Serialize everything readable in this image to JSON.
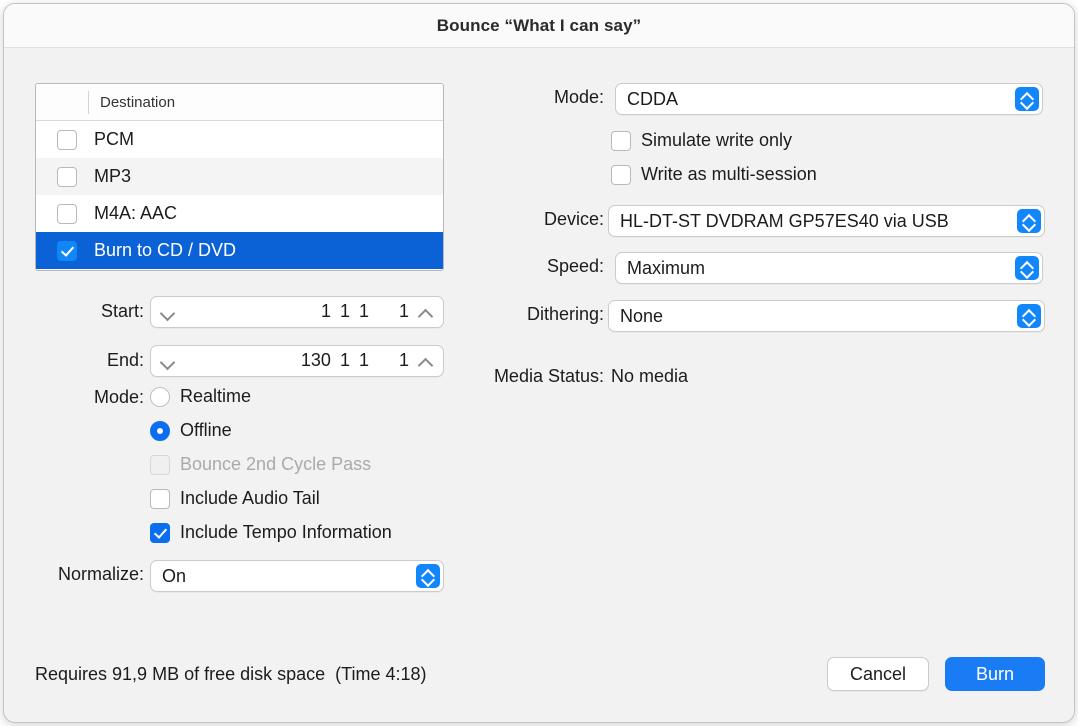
{
  "window": {
    "title": "Bounce “What I can say”"
  },
  "destination_table": {
    "column_header": "Destination",
    "rows": [
      {
        "label": "PCM",
        "checked": false,
        "selected": false
      },
      {
        "label": "MP3",
        "checked": false,
        "selected": false
      },
      {
        "label": "M4A: AAC",
        "checked": false,
        "selected": false
      },
      {
        "label": "Burn to CD / DVD",
        "checked": true,
        "selected": true
      }
    ]
  },
  "left_panel": {
    "start": {
      "label": "Start:",
      "values": [
        "1",
        "1",
        "1"
      ],
      "tick": "1",
      "decrement_icon": "chevron-down-icon",
      "increment_icon": "chevron-up-icon"
    },
    "end": {
      "label": "End:",
      "values": [
        "130",
        "1",
        "1"
      ],
      "tick": "1",
      "decrement_icon": "chevron-down-icon",
      "increment_icon": "chevron-up-icon"
    },
    "mode": {
      "label": "Mode:",
      "options": [
        {
          "label": "Realtime",
          "selected": false
        },
        {
          "label": "Offline",
          "selected": true
        }
      ]
    },
    "checkboxes": [
      {
        "label": "Bounce 2nd Cycle Pass",
        "checked": false,
        "disabled": true
      },
      {
        "label": "Include Audio Tail",
        "checked": false,
        "disabled": false
      },
      {
        "label": "Include Tempo Information",
        "checked": true,
        "disabled": false
      }
    ],
    "normalize": {
      "label": "Normalize:",
      "value": "On"
    }
  },
  "right_panel": {
    "mode": {
      "label": "Mode:",
      "value": "CDDA"
    },
    "checkboxes": [
      {
        "label": "Simulate write only",
        "checked": false
      },
      {
        "label": "Write as multi-session",
        "checked": false
      }
    ],
    "device": {
      "label": "Device:",
      "value": "HL-DT-ST DVDRAM GP57ES40 via USB"
    },
    "speed": {
      "label": "Speed:",
      "value": "Maximum"
    },
    "dithering": {
      "label": "Dithering:",
      "value": "None"
    },
    "media_status": {
      "label": "Media Status:",
      "value": "No media"
    }
  },
  "footer": {
    "disk_space_text": "Requires 91,9 MB of free disk space  (Time 4:18)",
    "cancel_label": "Cancel",
    "burn_label": "Burn"
  },
  "colors": {
    "accent_blue": "#1a7cf5",
    "selection_blue": "#0b62d6",
    "control_blue": "#1287fb",
    "window_bg": "#f2f2f2",
    "titlebar_bg": "#fafafa"
  }
}
